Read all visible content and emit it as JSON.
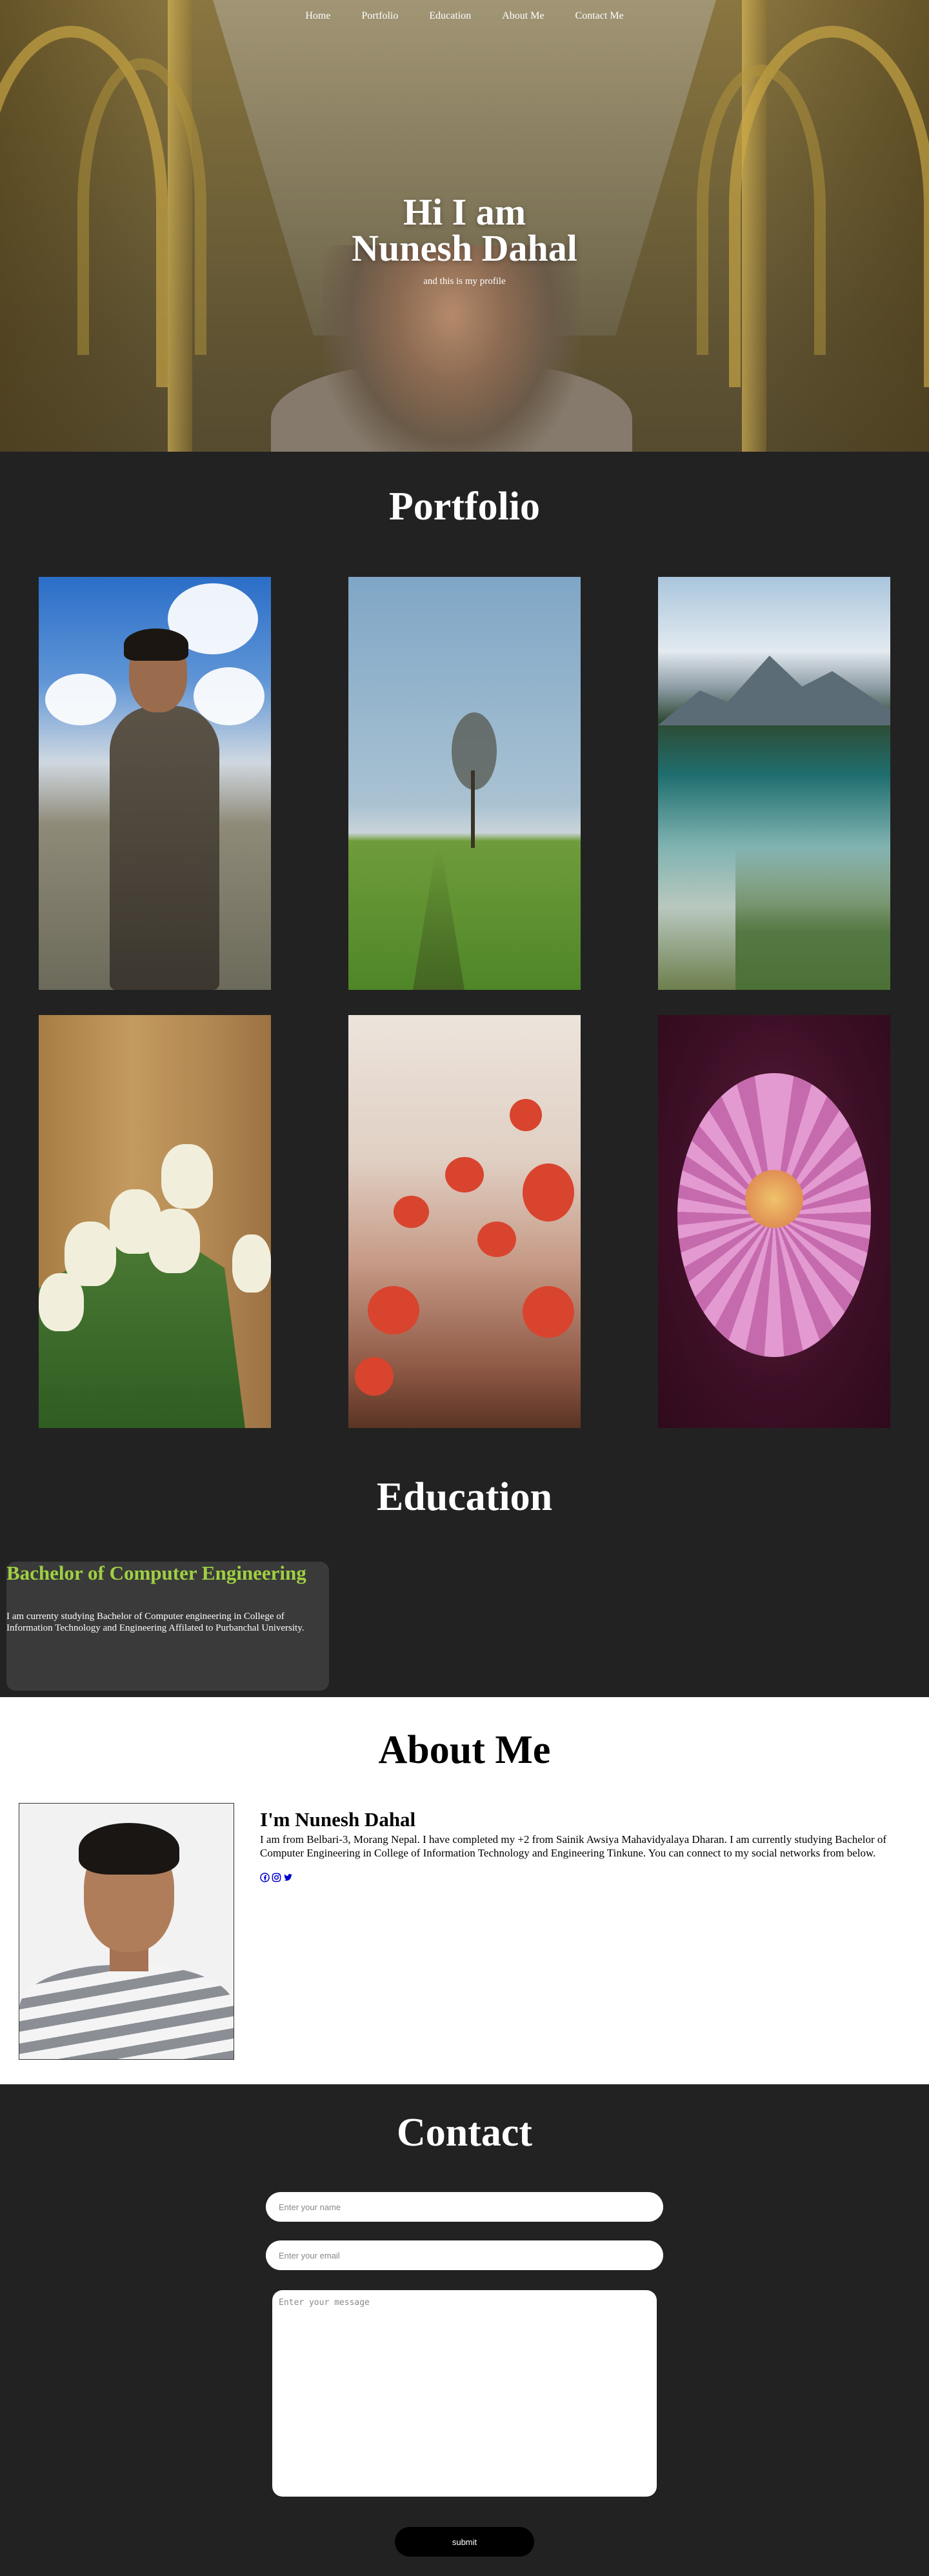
{
  "nav": {
    "items": [
      {
        "label": "Home"
      },
      {
        "label": "Portfolio"
      },
      {
        "label": "Education"
      },
      {
        "label": "About Me"
      },
      {
        "label": "Contact Me"
      }
    ]
  },
  "hero": {
    "line1": "Hi I am",
    "line2": "Nunesh Dahal",
    "subtitle": "and this is my profile"
  },
  "portfolio": {
    "title": "Portfolio"
  },
  "education": {
    "title": "Education",
    "card": {
      "heading": "Bachelor of Computer Engineering",
      "text": "I am currenty studying Bachelor of Computer engineering in College of Information Technology and Engineering Affilated to Purbanchal University."
    }
  },
  "about": {
    "title": "About Me",
    "name": "I'm Nunesh Dahal",
    "text": "I am from Belbari-3, Morang Nepal. I have completed my +2 from Sainik Awsiya Mahavidyalaya Dharan. I am currently studying Bachelor of Computer Engineering in College of Information Technology and Engineering Tinkune. You can connect to my social networks from below.",
    "socials": [
      "facebook-icon",
      "instagram-icon",
      "twitter-icon"
    ]
  },
  "contact": {
    "title": "Contact",
    "name_placeholder": "Enter your name",
    "email_placeholder": "Enter your email",
    "message_placeholder": "Enter your message",
    "submit_label": "submit"
  },
  "colors": {
    "page_bg": "#222222",
    "edu_card_bg": "#3a3a3a",
    "edu_heading": "#9fd042",
    "about_bg": "#ffffff",
    "submit_bg": "#000000"
  }
}
